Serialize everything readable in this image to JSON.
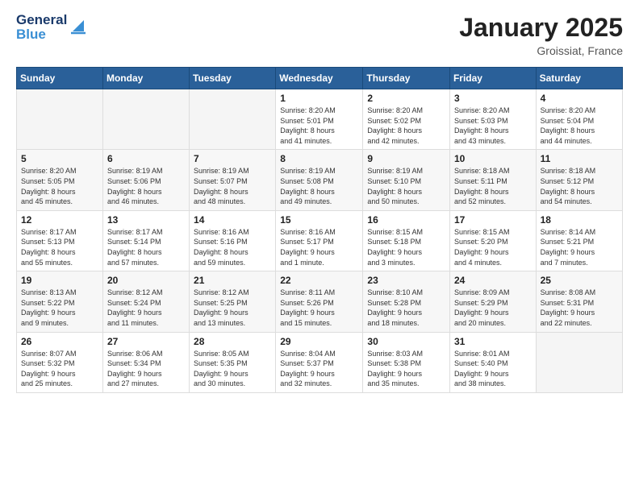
{
  "header": {
    "logo_line1": "General",
    "logo_line2": "Blue",
    "month": "January 2025",
    "location": "Groissiat, France"
  },
  "weekdays": [
    "Sunday",
    "Monday",
    "Tuesday",
    "Wednesday",
    "Thursday",
    "Friday",
    "Saturday"
  ],
  "weeks": [
    [
      {
        "day": "",
        "info": ""
      },
      {
        "day": "",
        "info": ""
      },
      {
        "day": "",
        "info": ""
      },
      {
        "day": "1",
        "info": "Sunrise: 8:20 AM\nSunset: 5:01 PM\nDaylight: 8 hours\nand 41 minutes."
      },
      {
        "day": "2",
        "info": "Sunrise: 8:20 AM\nSunset: 5:02 PM\nDaylight: 8 hours\nand 42 minutes."
      },
      {
        "day": "3",
        "info": "Sunrise: 8:20 AM\nSunset: 5:03 PM\nDaylight: 8 hours\nand 43 minutes."
      },
      {
        "day": "4",
        "info": "Sunrise: 8:20 AM\nSunset: 5:04 PM\nDaylight: 8 hours\nand 44 minutes."
      }
    ],
    [
      {
        "day": "5",
        "info": "Sunrise: 8:20 AM\nSunset: 5:05 PM\nDaylight: 8 hours\nand 45 minutes."
      },
      {
        "day": "6",
        "info": "Sunrise: 8:19 AM\nSunset: 5:06 PM\nDaylight: 8 hours\nand 46 minutes."
      },
      {
        "day": "7",
        "info": "Sunrise: 8:19 AM\nSunset: 5:07 PM\nDaylight: 8 hours\nand 48 minutes."
      },
      {
        "day": "8",
        "info": "Sunrise: 8:19 AM\nSunset: 5:08 PM\nDaylight: 8 hours\nand 49 minutes."
      },
      {
        "day": "9",
        "info": "Sunrise: 8:19 AM\nSunset: 5:10 PM\nDaylight: 8 hours\nand 50 minutes."
      },
      {
        "day": "10",
        "info": "Sunrise: 8:18 AM\nSunset: 5:11 PM\nDaylight: 8 hours\nand 52 minutes."
      },
      {
        "day": "11",
        "info": "Sunrise: 8:18 AM\nSunset: 5:12 PM\nDaylight: 8 hours\nand 54 minutes."
      }
    ],
    [
      {
        "day": "12",
        "info": "Sunrise: 8:17 AM\nSunset: 5:13 PM\nDaylight: 8 hours\nand 55 minutes."
      },
      {
        "day": "13",
        "info": "Sunrise: 8:17 AM\nSunset: 5:14 PM\nDaylight: 8 hours\nand 57 minutes."
      },
      {
        "day": "14",
        "info": "Sunrise: 8:16 AM\nSunset: 5:16 PM\nDaylight: 8 hours\nand 59 minutes."
      },
      {
        "day": "15",
        "info": "Sunrise: 8:16 AM\nSunset: 5:17 PM\nDaylight: 9 hours\nand 1 minute."
      },
      {
        "day": "16",
        "info": "Sunrise: 8:15 AM\nSunset: 5:18 PM\nDaylight: 9 hours\nand 3 minutes."
      },
      {
        "day": "17",
        "info": "Sunrise: 8:15 AM\nSunset: 5:20 PM\nDaylight: 9 hours\nand 4 minutes."
      },
      {
        "day": "18",
        "info": "Sunrise: 8:14 AM\nSunset: 5:21 PM\nDaylight: 9 hours\nand 7 minutes."
      }
    ],
    [
      {
        "day": "19",
        "info": "Sunrise: 8:13 AM\nSunset: 5:22 PM\nDaylight: 9 hours\nand 9 minutes."
      },
      {
        "day": "20",
        "info": "Sunrise: 8:12 AM\nSunset: 5:24 PM\nDaylight: 9 hours\nand 11 minutes."
      },
      {
        "day": "21",
        "info": "Sunrise: 8:12 AM\nSunset: 5:25 PM\nDaylight: 9 hours\nand 13 minutes."
      },
      {
        "day": "22",
        "info": "Sunrise: 8:11 AM\nSunset: 5:26 PM\nDaylight: 9 hours\nand 15 minutes."
      },
      {
        "day": "23",
        "info": "Sunrise: 8:10 AM\nSunset: 5:28 PM\nDaylight: 9 hours\nand 18 minutes."
      },
      {
        "day": "24",
        "info": "Sunrise: 8:09 AM\nSunset: 5:29 PM\nDaylight: 9 hours\nand 20 minutes."
      },
      {
        "day": "25",
        "info": "Sunrise: 8:08 AM\nSunset: 5:31 PM\nDaylight: 9 hours\nand 22 minutes."
      }
    ],
    [
      {
        "day": "26",
        "info": "Sunrise: 8:07 AM\nSunset: 5:32 PM\nDaylight: 9 hours\nand 25 minutes."
      },
      {
        "day": "27",
        "info": "Sunrise: 8:06 AM\nSunset: 5:34 PM\nDaylight: 9 hours\nand 27 minutes."
      },
      {
        "day": "28",
        "info": "Sunrise: 8:05 AM\nSunset: 5:35 PM\nDaylight: 9 hours\nand 30 minutes."
      },
      {
        "day": "29",
        "info": "Sunrise: 8:04 AM\nSunset: 5:37 PM\nDaylight: 9 hours\nand 32 minutes."
      },
      {
        "day": "30",
        "info": "Sunrise: 8:03 AM\nSunset: 5:38 PM\nDaylight: 9 hours\nand 35 minutes."
      },
      {
        "day": "31",
        "info": "Sunrise: 8:01 AM\nSunset: 5:40 PM\nDaylight: 9 hours\nand 38 minutes."
      },
      {
        "day": "",
        "info": ""
      }
    ]
  ]
}
